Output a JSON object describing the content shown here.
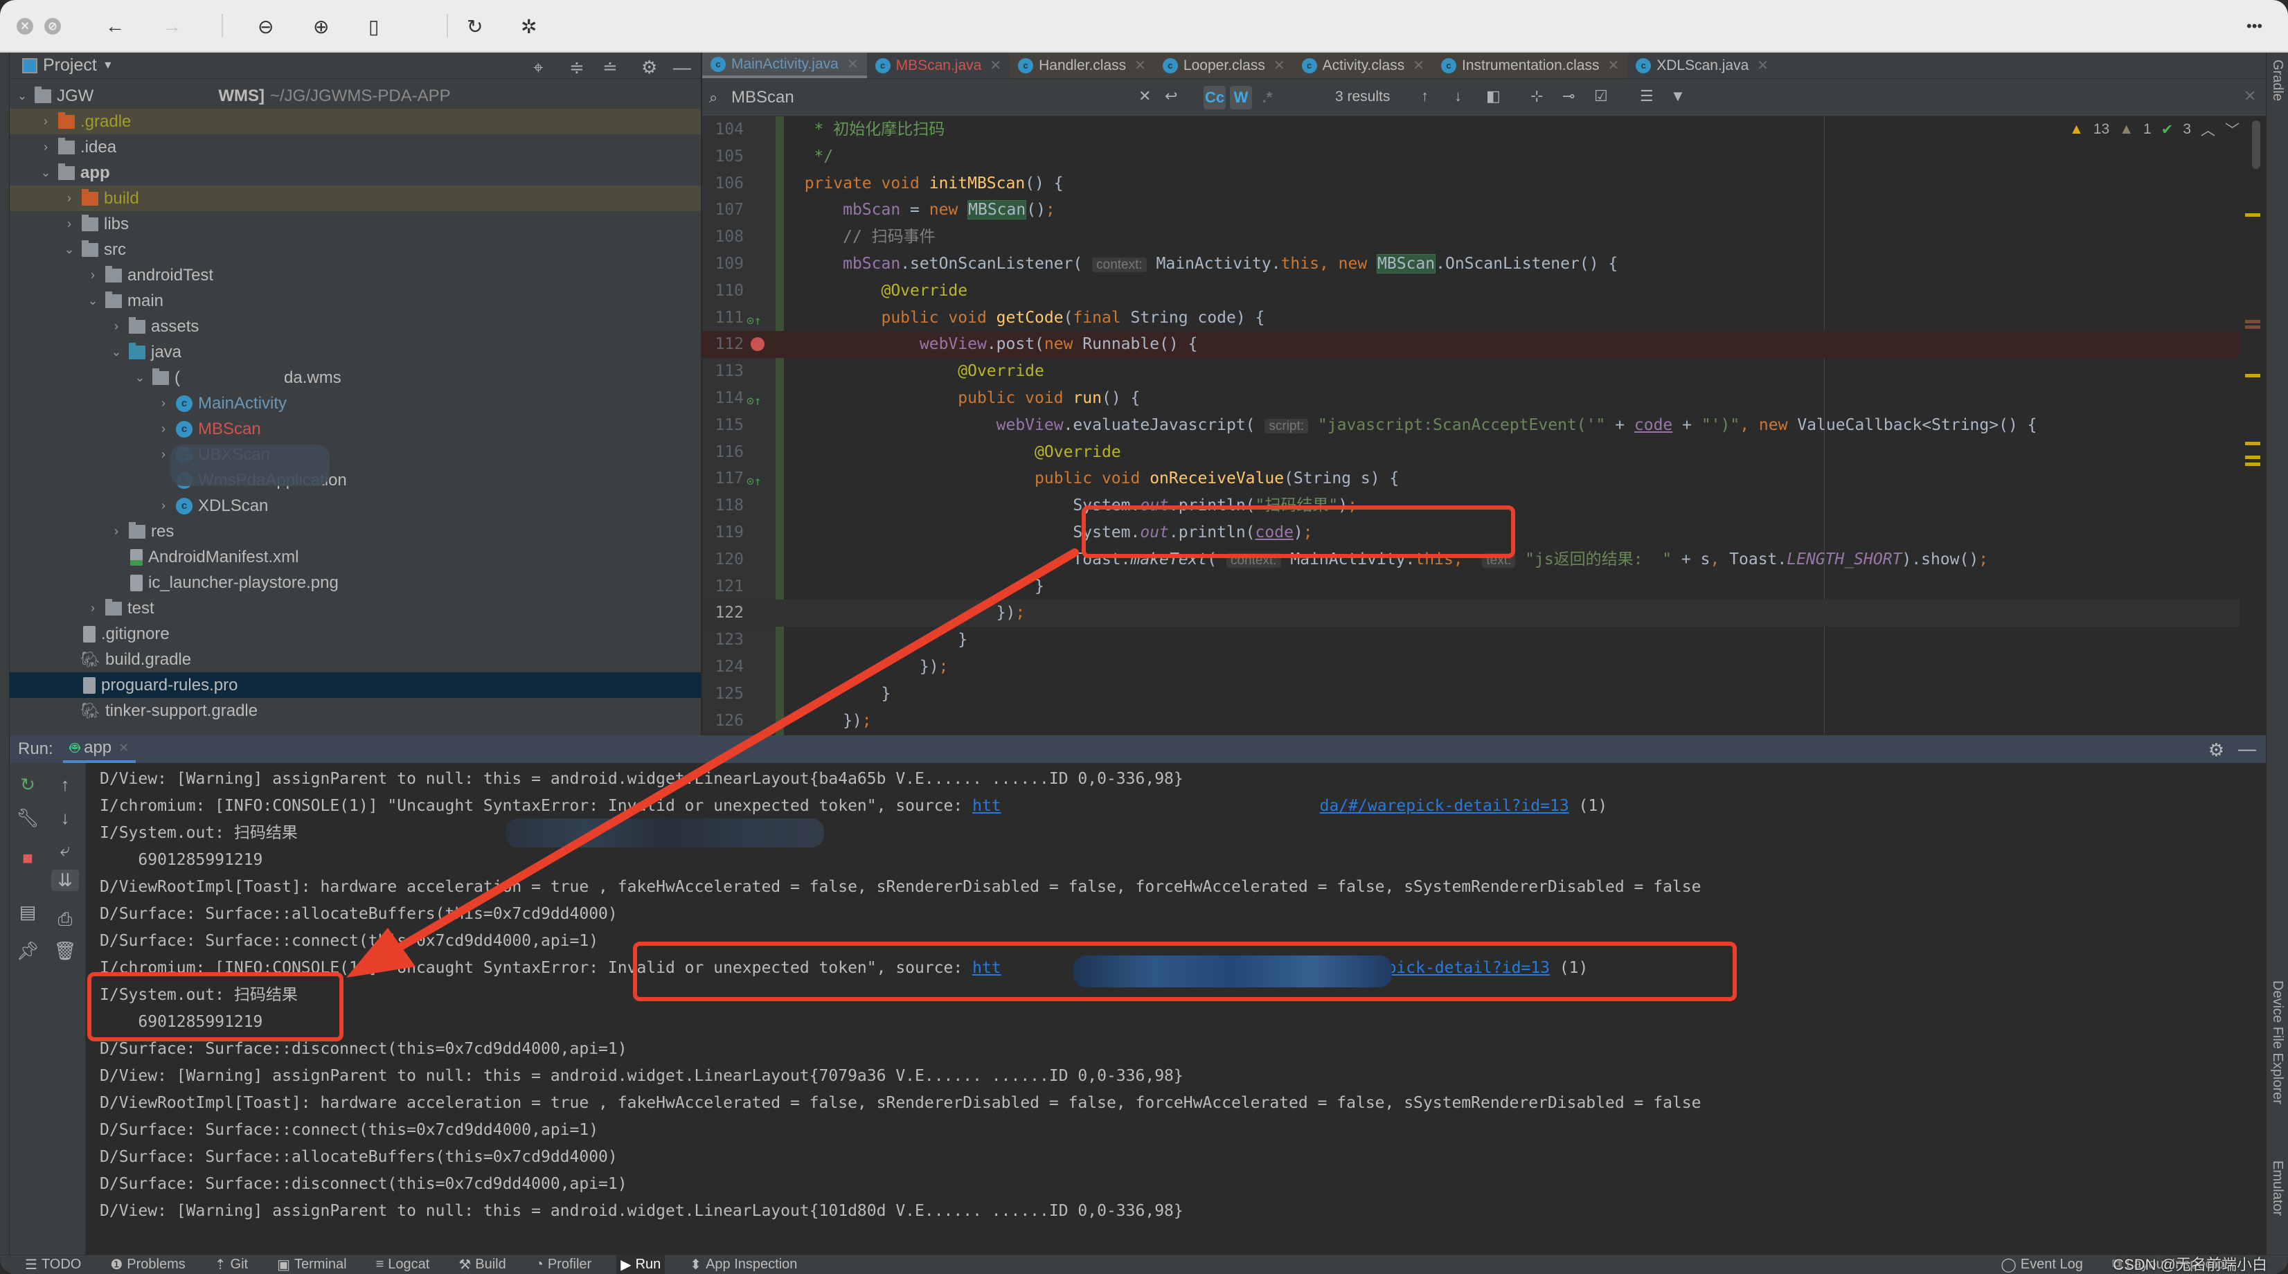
{
  "viewer": {
    "buttons": [
      "close",
      "disabled",
      "back",
      "forward",
      "zoom-out",
      "zoom-in",
      "actual-size",
      "rotate",
      "markup"
    ],
    "more_icon": "•••"
  },
  "project": {
    "title": "Project",
    "root": {
      "name_prefix": "JGW",
      "name_suffix": "WMS]",
      "path": "~/JG/JGWMS-PDA-APP"
    },
    "tree": [
      {
        "label": ".gradle",
        "type": "folder-excluded",
        "depth": 1,
        "chevron": "right"
      },
      {
        "label": ".idea",
        "type": "folder",
        "depth": 1,
        "chevron": "right"
      },
      {
        "label": "app",
        "type": "module",
        "depth": 1,
        "chevron": "down"
      },
      {
        "label": "build",
        "type": "folder-excluded",
        "depth": 2,
        "chevron": "right"
      },
      {
        "label": "libs",
        "type": "folder",
        "depth": 2,
        "chevron": "right"
      },
      {
        "label": "src",
        "type": "folder",
        "depth": 2,
        "chevron": "down"
      },
      {
        "label": "androidTest",
        "type": "folder",
        "depth": 3,
        "chevron": "right"
      },
      {
        "label": "main",
        "type": "folder",
        "depth": 3,
        "chevron": "down"
      },
      {
        "label": "assets",
        "type": "folder-res",
        "depth": 4,
        "chevron": "right"
      },
      {
        "label": "java",
        "type": "folder-src",
        "depth": 4,
        "chevron": "down"
      },
      {
        "label": "da.wms",
        "type": "package",
        "depth": 5,
        "chevron": "down"
      },
      {
        "label": "MainActivity",
        "type": "class-modified",
        "depth": 6,
        "chevron": "right"
      },
      {
        "label": "MBScan",
        "type": "class-error",
        "depth": 6,
        "chevron": "right"
      },
      {
        "label": "UBXScan",
        "type": "class",
        "depth": 6,
        "chevron": "right"
      },
      {
        "label": "WmsPdaApplication",
        "type": "class",
        "depth": 6,
        "chevron": ""
      },
      {
        "label": "XDLScan",
        "type": "class",
        "depth": 6,
        "chevron": "right"
      },
      {
        "label": "res",
        "type": "folder-res",
        "depth": 4,
        "chevron": "right"
      },
      {
        "label": "AndroidManifest.xml",
        "type": "manifest",
        "depth": 4,
        "chevron": ""
      },
      {
        "label": "ic_launcher-playstore.png",
        "type": "image",
        "depth": 4,
        "chevron": ""
      },
      {
        "label": "test",
        "type": "folder",
        "depth": 3,
        "chevron": "right"
      },
      {
        "label": ".gitignore",
        "type": "file",
        "depth": 2,
        "chevron": ""
      },
      {
        "label": "build.gradle",
        "type": "gradle",
        "depth": 2,
        "chevron": ""
      },
      {
        "label": "proguard-rules.pro",
        "type": "file-selected",
        "depth": 2,
        "chevron": ""
      },
      {
        "label": "tinker-support.gradle",
        "type": "gradle",
        "depth": 2,
        "chevron": ""
      }
    ]
  },
  "tabs": [
    {
      "label": "MainActivity.java",
      "state": "active",
      "color": "#6897bb"
    },
    {
      "label": "MBScan.java",
      "state": "normal",
      "color": "#d25252"
    },
    {
      "label": "Handler.class",
      "state": "library",
      "color": "#bbbbbb"
    },
    {
      "label": "Looper.class",
      "state": "library",
      "color": "#bbbbbb"
    },
    {
      "label": "Activity.class",
      "state": "library",
      "color": "#bbbbbb"
    },
    {
      "label": "Instrumentation.class",
      "state": "library",
      "color": "#bbbbbb"
    },
    {
      "label": "XDLScan.java",
      "state": "normal",
      "color": "#bbbbbb"
    }
  ],
  "find": {
    "query": "MBScan",
    "match_case": "Cc",
    "words": "W",
    "regex": ".*",
    "results": "3 results"
  },
  "inspections": {
    "warnings": "13",
    "weak_warnings": "1",
    "typos": "3"
  },
  "code_lines": [
    {
      "n": "104",
      "html": "   <span class='cmt'>* 初始化摩比扫码</span>"
    },
    {
      "n": "105",
      "html": "   <span class='cmt'>*/</span>"
    },
    {
      "n": "106",
      "html": "  <span class='kw'>private void </span><span class='fn'>initMBScan</span>() {"
    },
    {
      "n": "107",
      "html": "      <span class='fld'>mbScan</span> = <span class='kw'>new </span><span class='hl'>MBScan</span>()<span class='kw'>;</span>"
    },
    {
      "n": "108",
      "html": "      <span class='lc'>// 扫码事件</span>"
    },
    {
      "n": "109",
      "html": "      <span class='fld'>mbScan</span>.setOnScanListener( <span class='hint'>context:</span> MainActivity.<span class='kw'>this, new </span><span class='hl'>MBScan</span>.OnScanListener() {"
    },
    {
      "n": "110",
      "html": "          <span class='ann'>@Override</span>"
    },
    {
      "n": "111",
      "html": "          <span class='kw'>public void </span><span class='fn'>getCode</span>(<span class='kw'>final </span>String code) {"
    },
    {
      "n": "112",
      "html": "              <span class='fld'>webView</span>.post(<span class='kw'>new </span>Runnable() {"
    },
    {
      "n": "113",
      "html": "                  <span class='ann'>@Override</span>"
    },
    {
      "n": "114",
      "html": "                  <span class='kw'>public void </span><span class='fn'>run</span>() {"
    },
    {
      "n": "115",
      "html": "                      <span class='fld'>webView</span>.evaluateJavascript( <span class='hint'>script:</span> <span class='str'>\"javascript:ScanAcceptEvent('\"</span> + <span class='fld ul'>code</span> + <span class='str'>\"')\"</span><span class='kw'>, new </span>ValueCallback&lt;String&gt;() {"
    },
    {
      "n": "116",
      "html": "                          <span class='ann'>@Override</span>"
    },
    {
      "n": "117",
      "html": "                          <span class='kw'>public void </span><span class='fn'>onReceiveValue</span>(String s) {"
    },
    {
      "n": "118",
      "html": "                              System.<span class='fld it'>out</span>.println(<span class='str'>\"扫码结果\"</span>)<span class='kw'>;</span>"
    },
    {
      "n": "119",
      "html": "                              System.<span class='fld it'>out</span>.println(<span class='fld ul'>code</span>)<span class='kw'>;</span>"
    },
    {
      "n": "120",
      "html": "                              Toast.<span class='it'>makeText</span>( <span class='hint'>context:</span> MainActivity.<span class='kw'>this, </span> <span class='hint'>text:</span> <span class='str'>\"js返回的结果:  \"</span> + s<span class='kw'>, </span>Toast.<span class='fld it'>LENGTH_SHORT</span>).show()<span class='kw'>;</span>"
    },
    {
      "n": "121",
      "html": "                          }"
    },
    {
      "n": "122",
      "html": "                      })<span class='kw'>;</span>"
    },
    {
      "n": "123",
      "html": "                  }"
    },
    {
      "n": "124",
      "html": "              })<span class='kw'>;</span>"
    },
    {
      "n": "125",
      "html": "          }"
    },
    {
      "n": "126",
      "html": "      })<span class='kw'>;</span>"
    }
  ],
  "run": {
    "label": "Run:",
    "tab": "app",
    "console": [
      "D/View: [Warning] assignParent to null: this = android.widget.LinearLayout{ba4a65b V.E...... ......ID 0,0-336,98}",
      {
        "pre": "I/chromium: [INFO:CONSOLE(1)] \"Uncaught SyntaxError: Invalid or unexpected token\", source: ",
        "link_start": "htt",
        "link_end": "da/#/warepick-detail?id=13",
        "post": " (1)"
      },
      "I/System.out: 扫码结果",
      "    6901285991219",
      "D/ViewRootImpl[Toast]: hardware acceleration = true , fakeHwAccelerated = false, sRendererDisabled = false, forceHwAccelerated = false, sSystemRendererDisabled = false",
      "D/Surface: Surface::allocateBuffers(this=0x7cd9dd4000)",
      "D/Surface: Surface::connect(this=0x7cd9dd4000,api=1)",
      {
        "pre": "I/chromium: [INFO:CONSOLE(1)] \"Uncaught SyntaxError: Invalid or unexpected token\", source: ",
        "link_start": "htt",
        "link_end": "/#/warepick-detail?id=13",
        "post": " (1)"
      },
      "I/System.out: 扫码结果",
      "    6901285991219",
      "D/Surface: Surface::disconnect(this=0x7cd9dd4000,api=1)",
      "D/View: [Warning] assignParent to null: this = android.widget.LinearLayout{7079a36 V.E...... ......ID 0,0-336,98}",
      "D/ViewRootImpl[Toast]: hardware acceleration = true , fakeHwAccelerated = false, sRendererDisabled = false, forceHwAccelerated = false, sSystemRendererDisabled = false",
      "D/Surface: Surface::connect(this=0x7cd9dd4000,api=1)",
      "D/Surface: Surface::allocateBuffers(this=0x7cd9dd4000)",
      "D/Surface: Surface::disconnect(this=0x7cd9dd4000,api=1)",
      "D/View: [Warning] assignParent to null: this = android.widget.LinearLayout{101d80d V.E...... ......ID 0,0-336,98}"
    ]
  },
  "side_tools": {
    "right_top": "Gradle",
    "right_bottom": [
      "Device File Explorer",
      "Emulator"
    ]
  },
  "bottom_bar": {
    "items": [
      {
        "label": "TODO",
        "icon": "☰"
      },
      {
        "label": "Problems",
        "icon": "❶"
      },
      {
        "label": "Git",
        "icon": "⇡"
      },
      {
        "label": "Terminal",
        "icon": "▣"
      },
      {
        "label": "Logcat",
        "icon": "≡"
      },
      {
        "label": "Build",
        "icon": "⚒"
      },
      {
        "label": "Profiler",
        "icon": "◔"
      },
      {
        "label": "Run",
        "icon": "▶",
        "active": true
      },
      {
        "label": "App Inspection",
        "icon": "⬍"
      }
    ],
    "right_items": [
      {
        "label": "Event Log",
        "icon": "◯"
      },
      {
        "label": "Layout Inspector",
        "icon": "⧉"
      }
    ],
    "watermark": "CSDN @无名前端小白"
  },
  "annotation_color": "#e8402a"
}
